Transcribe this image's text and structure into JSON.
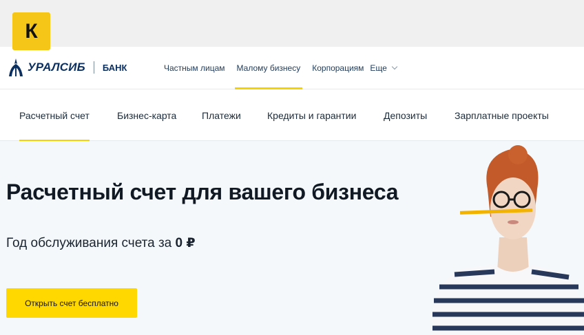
{
  "badge": {
    "letter": "К"
  },
  "logo": {
    "name": "УРАЛСИБ",
    "bank": "БАНК"
  },
  "topnav": {
    "items": [
      {
        "label": "Частным лицам",
        "active": false
      },
      {
        "label": "Малому бизнесу",
        "active": true
      },
      {
        "label": "Корпорациям",
        "active": false
      },
      {
        "label": "Еще",
        "active": false
      }
    ]
  },
  "subnav": {
    "items": [
      {
        "label": "Расчетный счет",
        "active": true
      },
      {
        "label": "Бизнес-карта",
        "active": false
      },
      {
        "label": "Платежи",
        "active": false
      },
      {
        "label": "Кредиты и гарантии",
        "active": false
      },
      {
        "label": "Депозиты",
        "active": false
      },
      {
        "label": "Зарплатные проекты",
        "active": false
      }
    ]
  },
  "hero": {
    "title": "Расчетный счет для вашего бизнеса",
    "subtitle_prefix": "Год обслуживания счета за ",
    "subtitle_value": "0 ₽",
    "cta_label": "Открыть счет бесплатно"
  },
  "colors": {
    "accent": "#ffd800",
    "brand": "#0b2f5f",
    "badge": "#f5c518"
  }
}
